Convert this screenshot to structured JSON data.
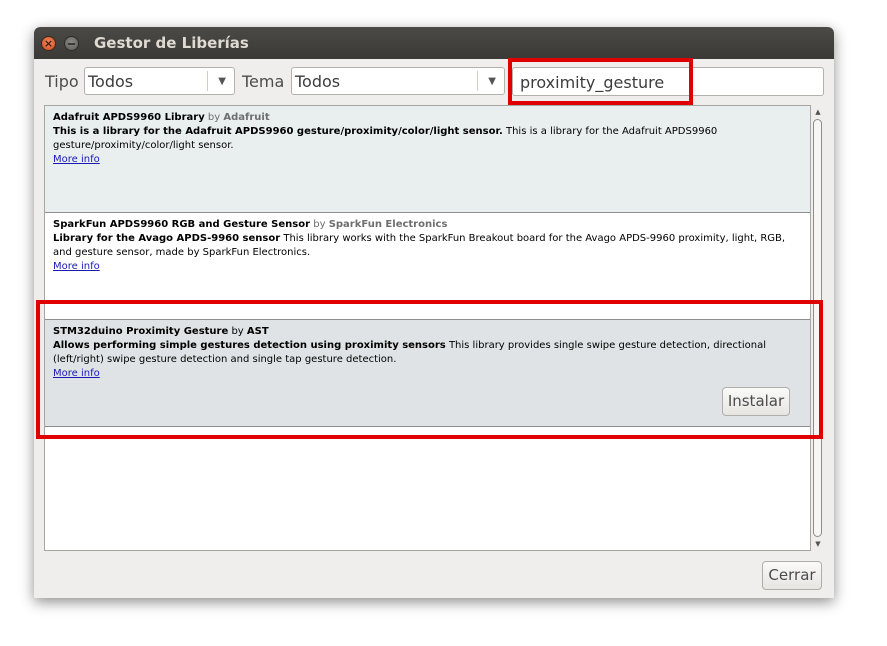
{
  "window": {
    "title": "Gestor de Liberías"
  },
  "filters": {
    "tipo_label": "Tipo",
    "tipo_value": "Todos",
    "tema_label": "Tema",
    "tema_value": "Todos",
    "search_value": "proximity_gesture"
  },
  "libraries": [
    {
      "name": "Adafruit APDS9960 Library",
      "by": "by",
      "author": "Adafruit",
      "summary": "This is a library for the Adafruit APDS9960 gesture/proximity/color/light sensor.",
      "description": "This is a library for the Adafruit APDS9960 gesture/proximity/color/light sensor.",
      "more_info": "More info"
    },
    {
      "name": "SparkFun APDS9960 RGB and Gesture Sensor",
      "by": "by",
      "author": "SparkFun Electronics",
      "summary": "Library for the Avago APDS-9960 sensor",
      "description": "This library works with the SparkFun Breakout board for the Avago APDS-9960 proximity, light, RGB, and gesture sensor, made by SparkFun Electronics.",
      "more_info": "More info"
    },
    {
      "name": "STM32duino Proximity Gesture",
      "by": "by",
      "author": "AST",
      "summary": "Allows performing simple gestures detection using proximity sensors",
      "description": "This library provides single swipe gesture detection, directional (left/right) swipe gesture detection and single tap gesture detection.",
      "more_info": "More info",
      "install_label": "Instalar"
    }
  ],
  "footer": {
    "close_label": "Cerrar"
  },
  "colors": {
    "highlight": "#e00000",
    "titlebar": "#3c3b37",
    "link": "#1a1ab8"
  },
  "icons": {
    "close": "close-icon",
    "minimize": "minimize-icon",
    "dropdown": "chevron-down-icon"
  }
}
